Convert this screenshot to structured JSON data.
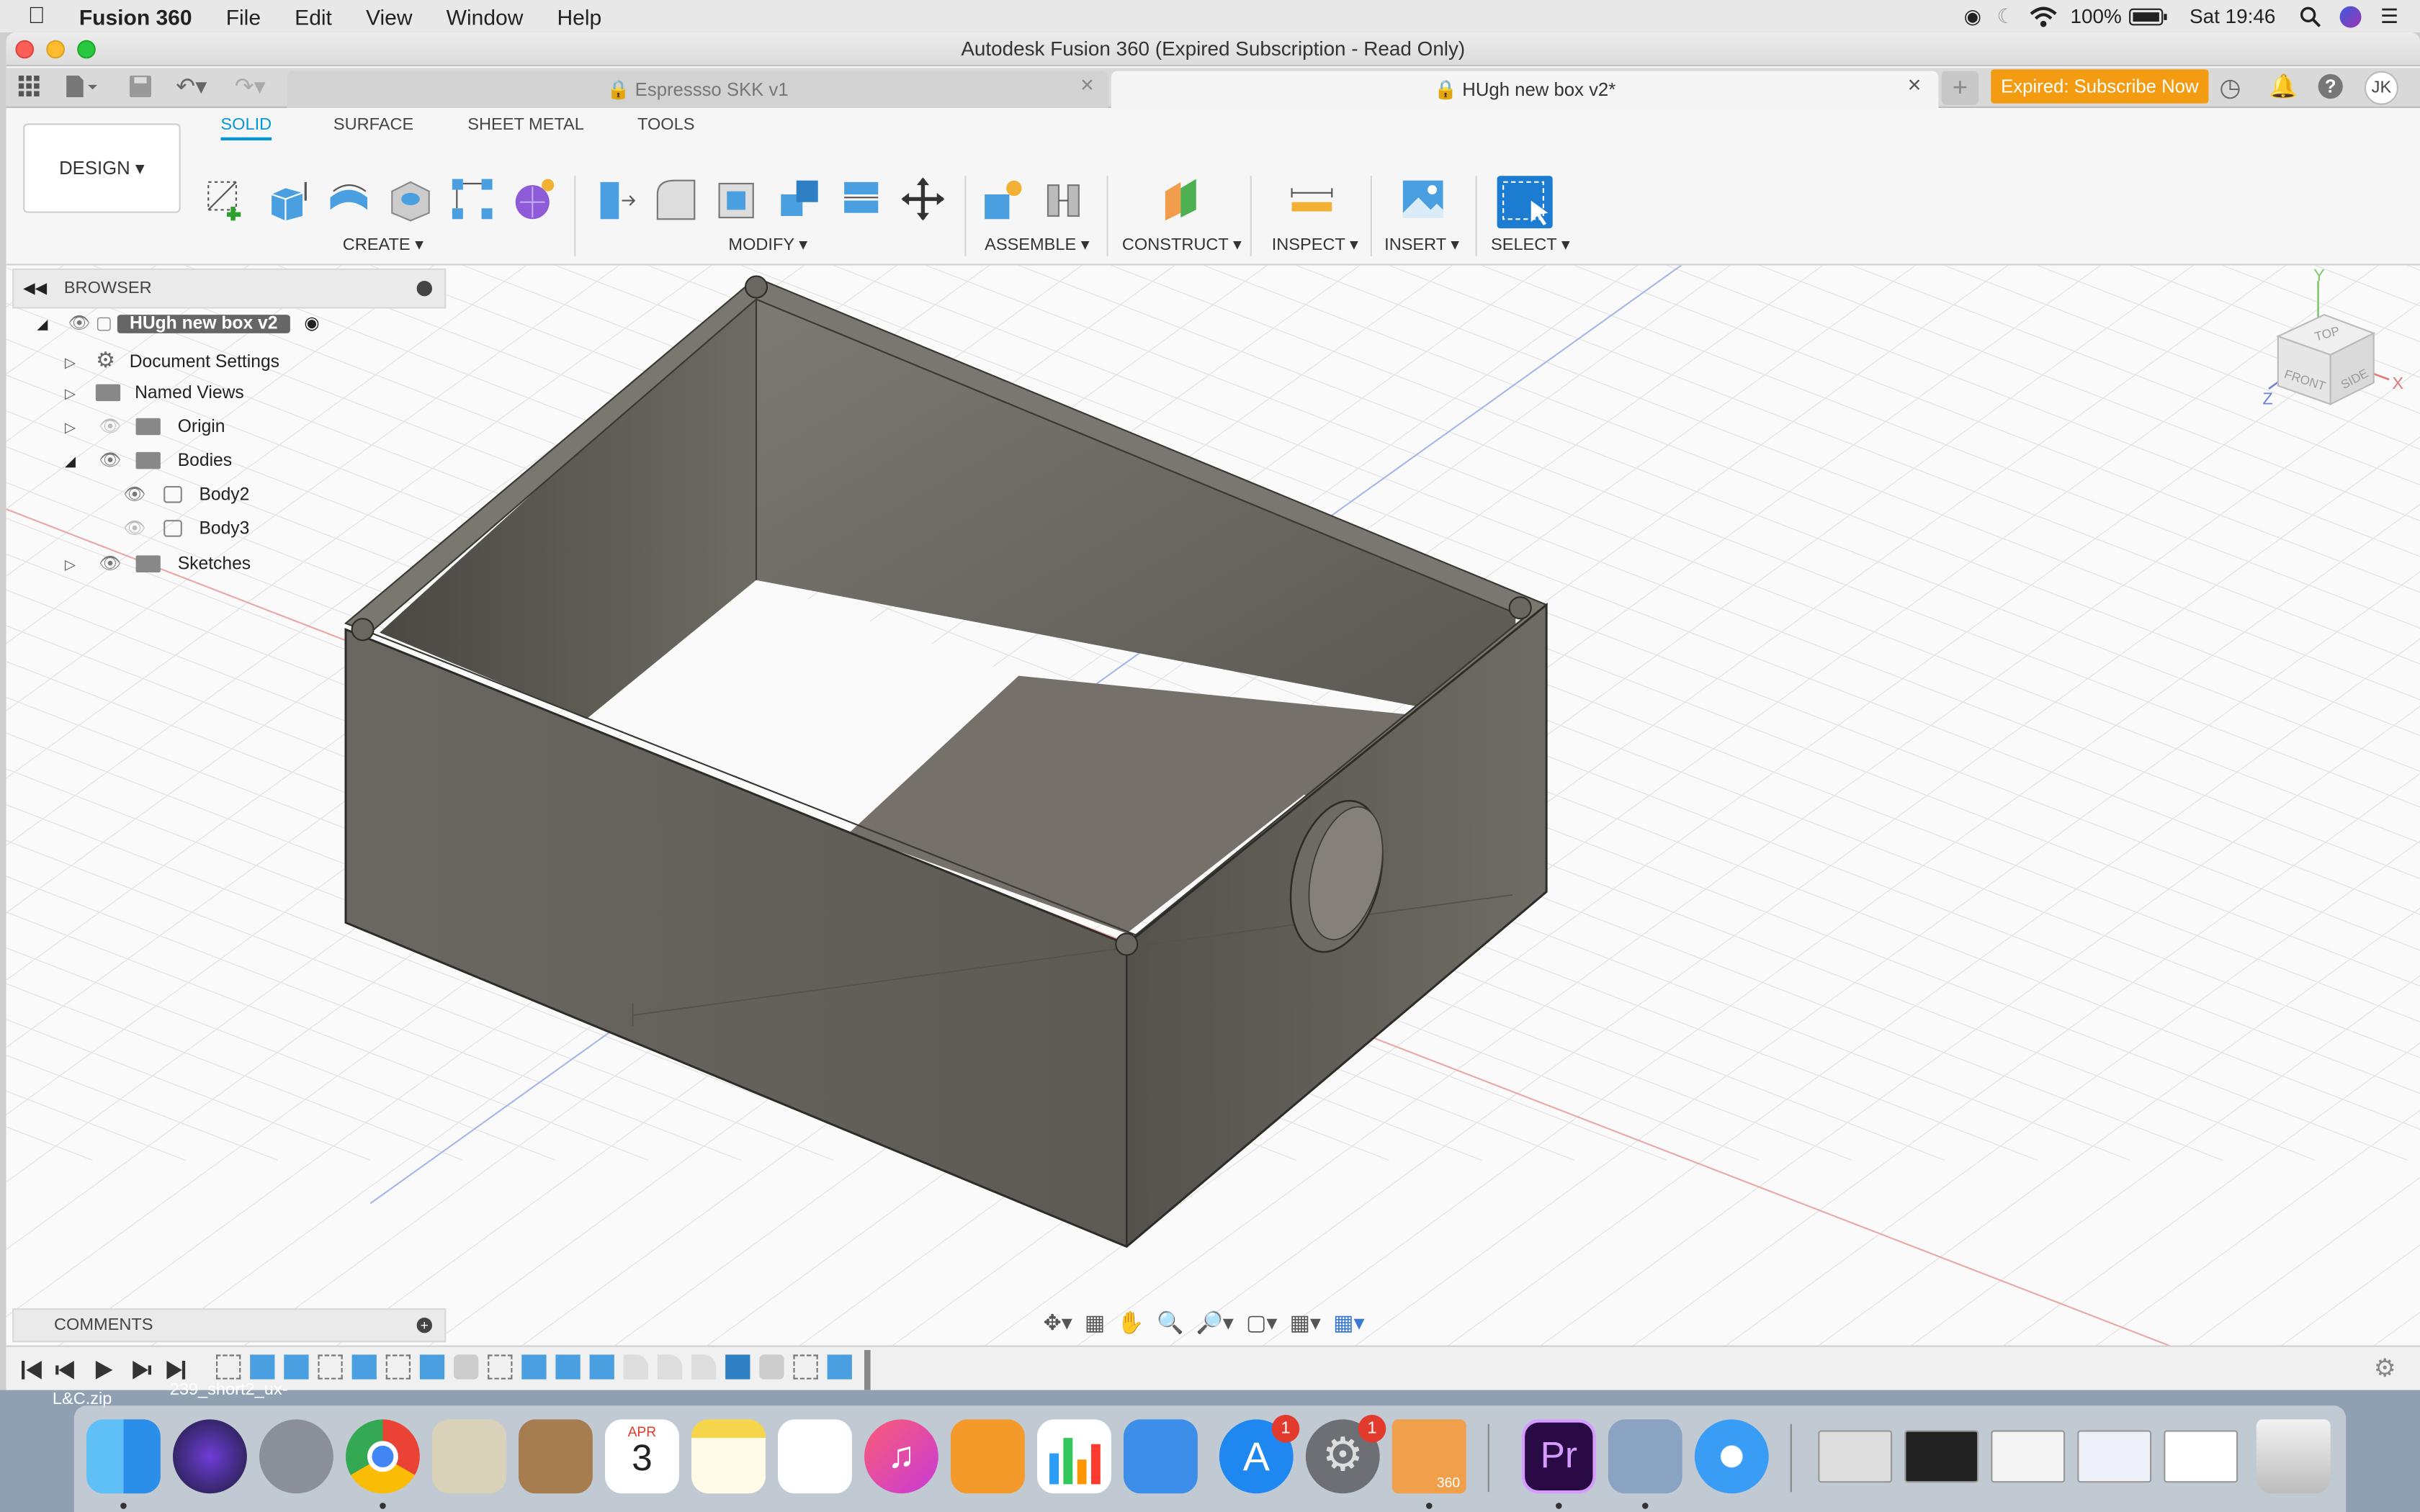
{
  "menubar": {
    "app_name": "Fusion 360",
    "menus": [
      "File",
      "Edit",
      "View",
      "Window",
      "Help"
    ],
    "battery": "100%",
    "clock": "Sat 19:46"
  },
  "window": {
    "title": "Autodesk Fusion 360 (Expired Subscription - Read Only)"
  },
  "tabs": [
    {
      "label": "Espressso SKK v1",
      "active": false
    },
    {
      "label": "HUgh new box v2*",
      "active": true
    }
  ],
  "subscribe_label": "Expired: Subscribe Now",
  "user_initials": "JK",
  "workspace_label": "DESIGN",
  "ribbon_tabs": [
    "SOLID",
    "SURFACE",
    "SHEET METAL",
    "TOOLS"
  ],
  "groups": [
    "CREATE",
    "MODIFY",
    "ASSEMBLE",
    "CONSTRUCT",
    "INSPECT",
    "INSERT",
    "SELECT"
  ],
  "browser": {
    "title": "BROWSER",
    "items": [
      {
        "label": "HUgh new box v2"
      },
      {
        "label": "Document Settings"
      },
      {
        "label": "Named Views"
      },
      {
        "label": "Origin"
      },
      {
        "label": "Bodies"
      },
      {
        "label": "Body2"
      },
      {
        "label": "Body3"
      },
      {
        "label": "Sketches"
      }
    ]
  },
  "comments_label": "COMMENTS",
  "viewcube": {
    "top": "TOP",
    "front": "FRONT",
    "side": "SIDE",
    "axis_x": "X",
    "axis_y": "Y",
    "axis_z": "Z"
  },
  "desktop_files": [
    "L&C.zip",
    "239_short2_ux-"
  ],
  "dock": {
    "calendar_month": "APR",
    "calendar_day": "3",
    "appstore_badge": "1",
    "prefs_badge": "1",
    "premiere_label": "Pr",
    "fusion_label": "360"
  },
  "colors": {
    "subscribe": "#f39c12",
    "active_tab": "#0696d7",
    "body": "#5f5c55"
  }
}
